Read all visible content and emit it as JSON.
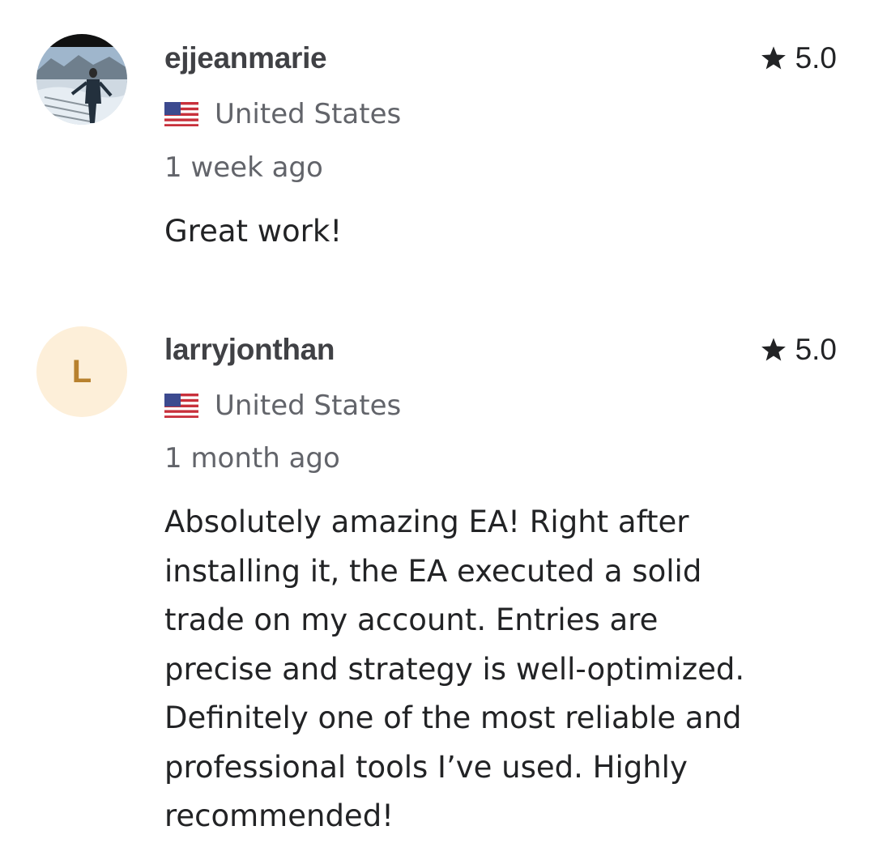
{
  "reviews": [
    {
      "username": "ejjeanmarie",
      "avatar": {
        "type": "photo",
        "description_icon": "user-photo"
      },
      "country": "United States",
      "country_flag_icon": "us-flag-icon",
      "rating": "5.0",
      "time": "1 week ago",
      "text": "Great work!"
    },
    {
      "username": "larryjonthan",
      "avatar": {
        "type": "initial",
        "initial": "L"
      },
      "country": "United States",
      "country_flag_icon": "us-flag-icon",
      "rating": "5.0",
      "time": "1 month ago",
      "text_lines": [
        "Absolutely amazing EA! Right after",
        "installing it, the EA executed a solid",
        "trade on my account. Entries are",
        "precise and strategy is well-optimized.",
        "Definitely one of the most reliable and",
        "professional tools I’ve used. Highly",
        "recommended!"
      ]
    }
  ],
  "colors": {
    "username": "#404145",
    "meta": "#62646a",
    "text": "#222325",
    "initial_bg": "#fdefd9",
    "initial_fg": "#b8812e"
  }
}
